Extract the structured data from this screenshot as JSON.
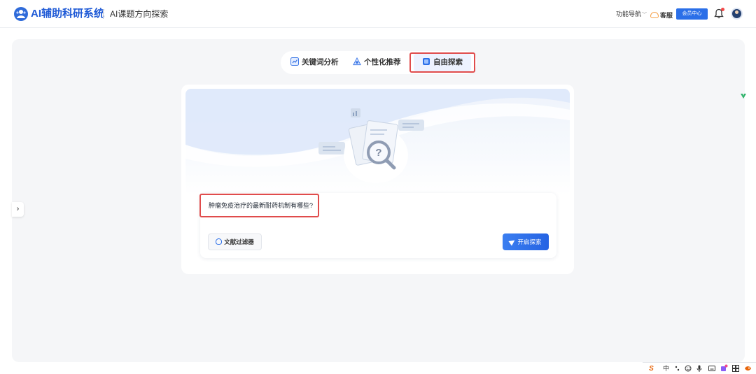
{
  "header": {
    "app_title": "AI辅助科研系统",
    "page_title": "AI课题方向探索",
    "nav_menu_label": "功能导航",
    "support_label": "客服",
    "member_button_label": "会员中心"
  },
  "tabs": [
    {
      "label": "关键词分析",
      "active": false
    },
    {
      "label": "个性化推荐",
      "active": false
    },
    {
      "label": "自由探索",
      "active": true
    }
  ],
  "explore": {
    "question_text": "肿瘤免疫治疗的最新耐药机制有哪些?",
    "filter_button_label": "文献过滤器",
    "start_button_label": "开启探索"
  },
  "tray": {
    "ime_label": "中"
  },
  "colors": {
    "primary": "#2b6fe8",
    "brand_text": "#1f5ad6",
    "highlight_border": "#e04c4c",
    "panel_background": "#f5f6f8"
  },
  "icons": {
    "logo": "logo-icon",
    "bell": "bell-icon",
    "chevron_right": "chevron-right-icon",
    "send": "send-icon",
    "question_search": "search-illustration"
  }
}
